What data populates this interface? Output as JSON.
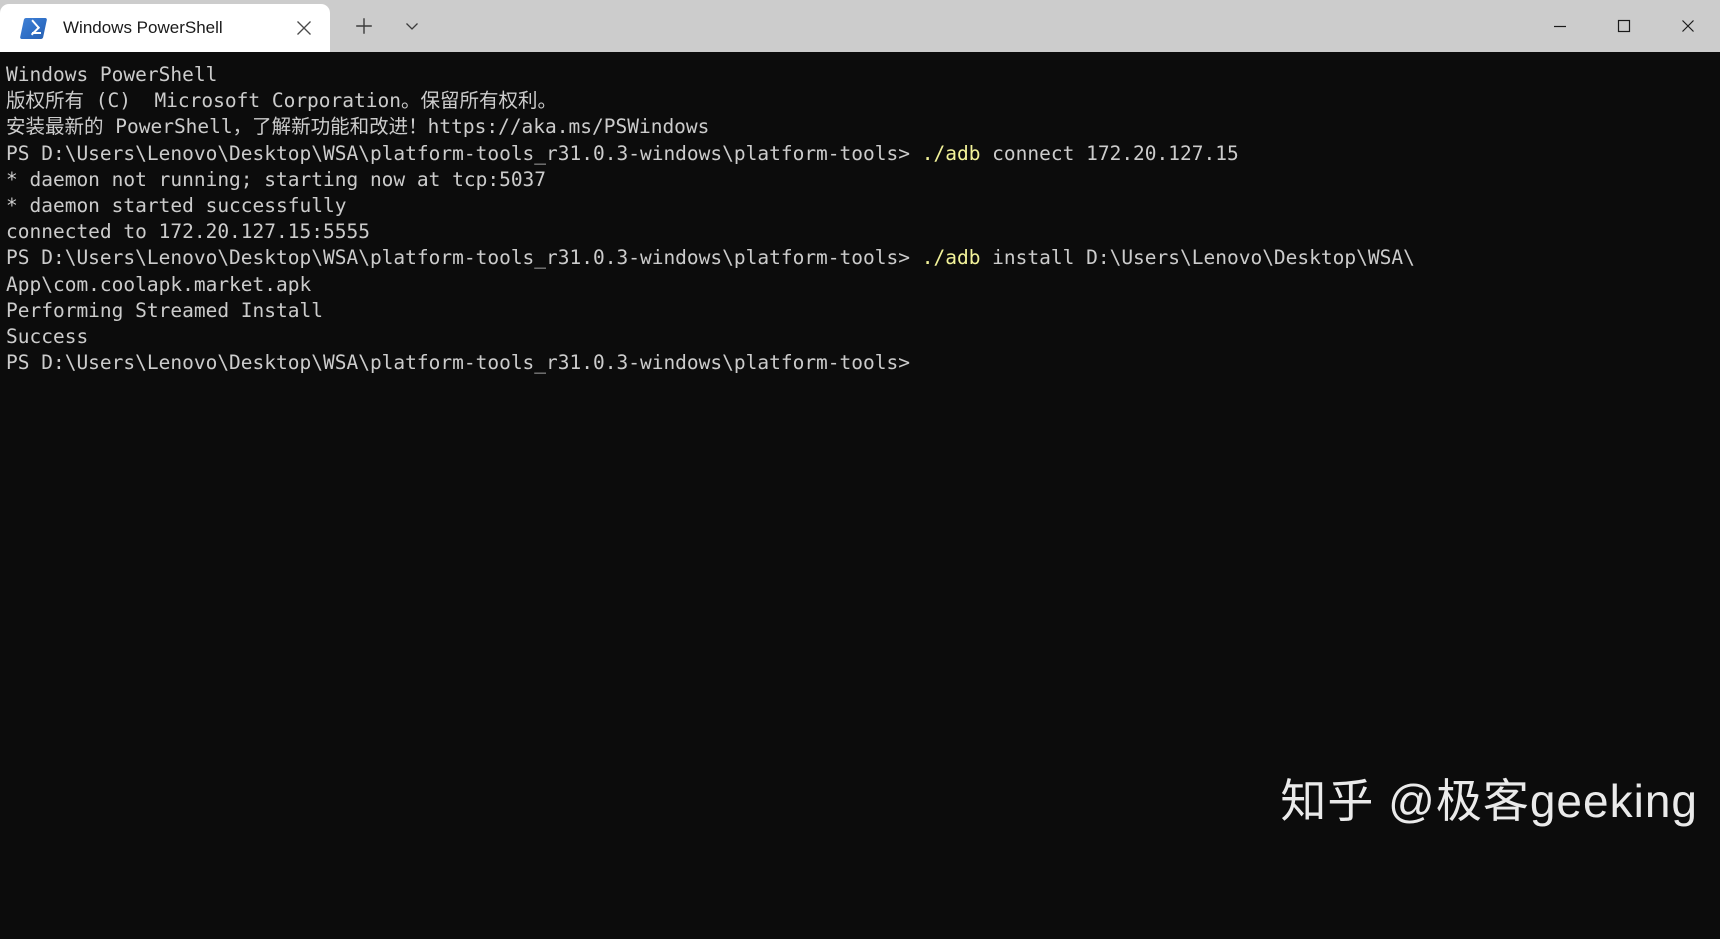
{
  "window": {
    "tab": {
      "title": "Windows PowerShell",
      "icon": "powershell-icon",
      "close_label": "✕"
    },
    "new_tab_label": "+",
    "tab_menu_label": "⌄",
    "controls": {
      "minimize_label": "—",
      "maximize_label": "□",
      "close_label": "✕"
    }
  },
  "terminal": {
    "background_color": "#0c0c0c",
    "foreground_color": "#cccccc",
    "command_color": "#f3f39a",
    "lines": [
      {
        "text": "Windows PowerShell",
        "type": "output"
      },
      {
        "text": "版权所有 (C)  Microsoft Corporation。保留所有权利。",
        "type": "output"
      },
      {
        "text": "",
        "type": "blank"
      },
      {
        "text": "安装最新的 PowerShell，了解新功能和改进！https://aka.ms/PSWindows",
        "type": "output"
      },
      {
        "text": "",
        "type": "blank"
      },
      {
        "prompt": "PS D:\\Users\\Lenovo\\Desktop\\WSA\\platform-tools_r31.0.3-windows\\platform-tools> ",
        "command": "./adb",
        "args": " connect 172.20.127.15",
        "type": "prompt"
      },
      {
        "text": "* daemon not running; starting now at tcp:5037",
        "type": "output"
      },
      {
        "text": "* daemon started successfully",
        "type": "output"
      },
      {
        "text": "connected to 172.20.127.15:5555",
        "type": "output"
      },
      {
        "prompt": "PS D:\\Users\\Lenovo\\Desktop\\WSA\\platform-tools_r31.0.3-windows\\platform-tools> ",
        "command": "./adb",
        "args": " install D:\\Users\\Lenovo\\Desktop\\WSA\\",
        "type": "prompt"
      },
      {
        "text": "App\\com.coolapk.market.apk",
        "type": "output"
      },
      {
        "text": "Performing Streamed Install",
        "type": "output"
      },
      {
        "text": "Success",
        "type": "output"
      },
      {
        "prompt": "PS D:\\Users\\Lenovo\\Desktop\\WSA\\platform-tools_r31.0.3-windows\\platform-tools>",
        "command": "",
        "args": "",
        "type": "prompt"
      }
    ]
  },
  "watermark": {
    "text": "知乎 @极客geeking"
  }
}
